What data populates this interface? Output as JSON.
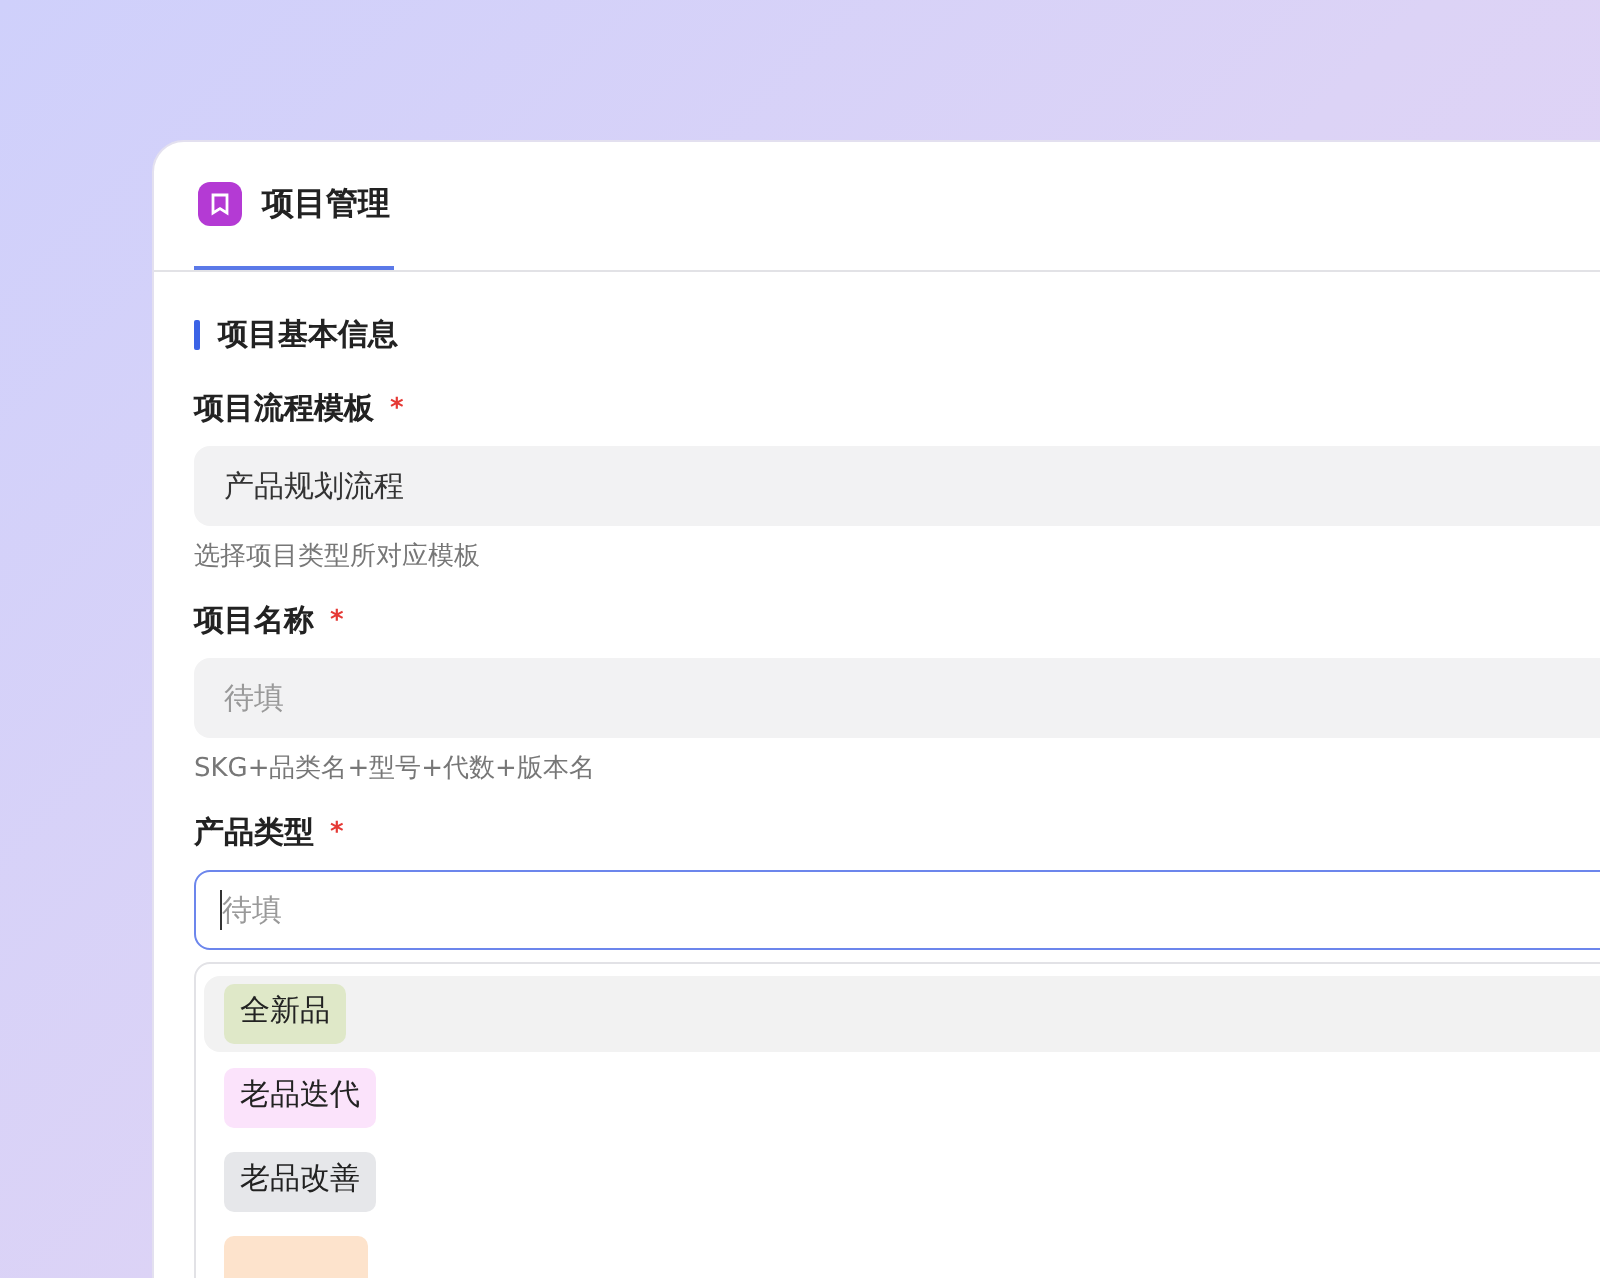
{
  "header": {
    "title": "项目管理",
    "tab_selected": true
  },
  "section": {
    "title": "项目基本信息"
  },
  "fields": [
    {
      "label": "项目流程模板",
      "required_mark": "*",
      "value": "产品规划流程",
      "focused": false,
      "hint": "选择项目类型所对应模板"
    },
    {
      "label": "项目名称",
      "required_mark": "*",
      "placeholder": "待填",
      "focused": false,
      "hint": "SKG+品类名+型号+代数+版本名"
    },
    {
      "label": "产品类型",
      "required_mark": "*",
      "placeholder": "待填",
      "focused": true
    }
  ],
  "dropdown": {
    "options": [
      {
        "label": "全新品",
        "color": "#dfe8c8",
        "highlighted": true
      },
      {
        "label": "老品迭代",
        "color": "#fbe3fb",
        "highlighted": false
      },
      {
        "label": "老品改善",
        "color": "#e6e7ea",
        "highlighted": false
      },
      {
        "color": "#fde3cc",
        "highlighted": false
      }
    ]
  }
}
